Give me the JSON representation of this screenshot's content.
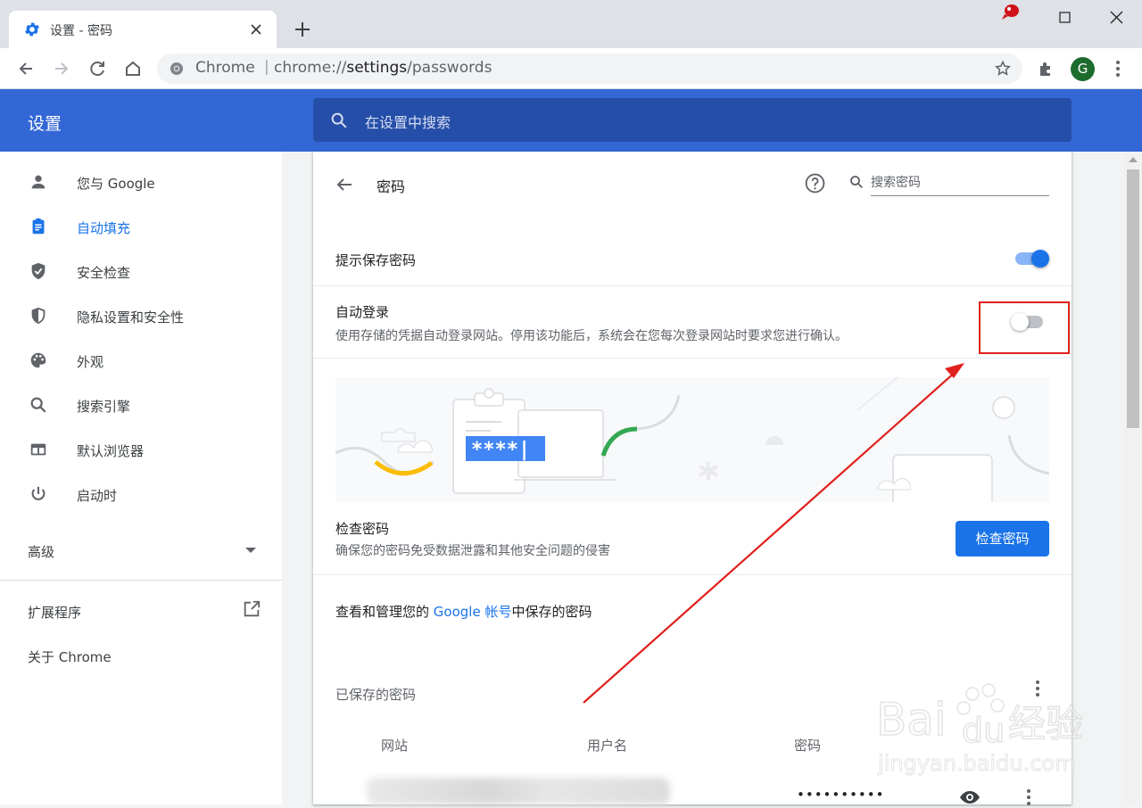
{
  "tab": {
    "title": "设置 - 密码"
  },
  "omnibox": {
    "origin": "Chrome",
    "separator": "|",
    "url_prefix": "chrome://",
    "url_host": "settings",
    "url_path": "/passwords"
  },
  "profile": {
    "initial": "G",
    "color": "#1e6b2e"
  },
  "header": {
    "title": "设置",
    "search_placeholder": "在设置中搜索"
  },
  "sidebar": {
    "items": [
      {
        "label": "您与 Google",
        "icon": "person-icon"
      },
      {
        "label": "自动填充",
        "icon": "clipboard-icon",
        "active": true
      },
      {
        "label": "安全检查",
        "icon": "shield-check-icon"
      },
      {
        "label": "隐私设置和安全性",
        "icon": "shield-half-icon"
      },
      {
        "label": "外观",
        "icon": "palette-icon"
      },
      {
        "label": "搜索引擎",
        "icon": "search-icon"
      },
      {
        "label": "默认浏览器",
        "icon": "browser-icon"
      },
      {
        "label": "启动时",
        "icon": "power-icon"
      }
    ],
    "advanced": "高级",
    "extensions": "扩展程序",
    "about": "关于 Chrome"
  },
  "page": {
    "title": "密码",
    "search_placeholder": "搜索密码",
    "offer_to_save": {
      "label": "提示保存密码",
      "enabled": true
    },
    "auto_signin": {
      "label": "自动登录",
      "description": "使用存储的凭据自动登录网站。停用该功能后，系统会在您每次登录网站时要求您进行确认。",
      "enabled": false
    },
    "illustration": {
      "masked_password": "****|"
    },
    "check_passwords": {
      "title": "检查密码",
      "description": "确保您的密码免受数据泄露和其他安全问题的侵害",
      "button": "检查密码"
    },
    "manage": {
      "prefix": "查看和管理您的 ",
      "link": "Google 帐号",
      "suffix": "中保存的密码"
    },
    "saved": {
      "title": "已保存的密码",
      "columns": [
        "网站",
        "用户名",
        "密码"
      ],
      "first_row_password": "••••••••••"
    }
  },
  "watermark": {
    "brand_left": "Bai",
    "brand_right": "du",
    "brand_cn": "经验",
    "domain": "jingyan.baidu.com"
  },
  "colors": {
    "accent": "#1a73e8",
    "header": "#3367d6",
    "header_search": "#254ea8",
    "annotation": "#e0201c"
  }
}
